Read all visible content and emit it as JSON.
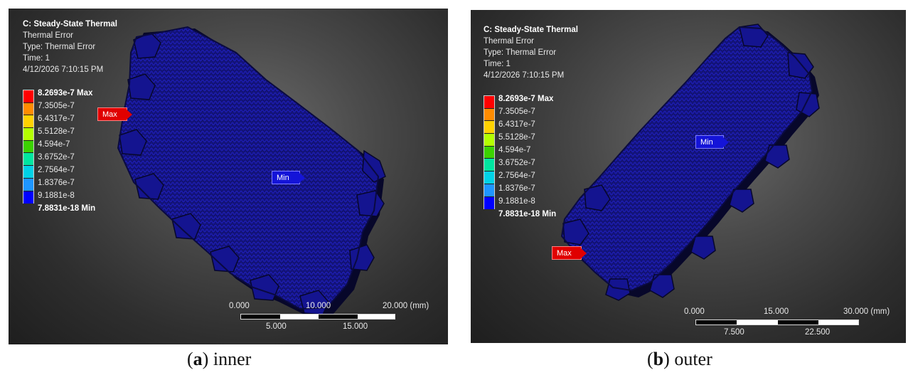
{
  "panels": [
    {
      "info": {
        "title": "C: Steady-State Thermal",
        "line2": "Thermal Error",
        "line3": "Type: Thermal Error",
        "line4": "Time: 1",
        "line5": "4/12/2026 7:10:15 PM"
      },
      "legend": {
        "colors": [
          "#ff0000",
          "#ff8c00",
          "#ffd200",
          "#b4ff00",
          "#3cd200",
          "#00e6a0",
          "#00d2e6",
          "#1e96ff",
          "#0000ff"
        ],
        "labels": [
          "8.2693e-7 Max",
          "7.3505e-7",
          "6.4317e-7",
          "5.5128e-7",
          "4.594e-7",
          "3.6752e-7",
          "2.7564e-7",
          "1.8376e-7",
          "9.1881e-8",
          "7.8831e-18 Min"
        ]
      },
      "probe": {
        "max": "Max",
        "min": "Min"
      },
      "scale": {
        "top": [
          "0.000",
          "10.000",
          "20.000 (mm)"
        ],
        "bottom": [
          "5.000",
          "15.000"
        ]
      },
      "caption": {
        "letter": "a",
        "text": "inner"
      }
    },
    {
      "info": {
        "title": "C: Steady-State Thermal",
        "line2": "Thermal Error",
        "line3": "Type: Thermal Error",
        "line4": "Time: 1",
        "line5": "4/12/2026 7:10:15 PM"
      },
      "legend": {
        "colors": [
          "#ff0000",
          "#ff8c00",
          "#ffd200",
          "#b4ff00",
          "#3cd200",
          "#00e6a0",
          "#00d2e6",
          "#1e96ff",
          "#0000ff"
        ],
        "labels": [
          "8.2693e-7 Max",
          "7.3505e-7",
          "6.4317e-7",
          "5.5128e-7",
          "4.594e-7",
          "3.6752e-7",
          "2.7564e-7",
          "1.8376e-7",
          "9.1881e-8",
          "7.8831e-18 Min"
        ]
      },
      "probe": {
        "max": "Max",
        "min": "Min"
      },
      "scale": {
        "top": [
          "0.000",
          "15.000",
          "30.000 (mm)"
        ],
        "bottom": [
          "7.500",
          "22.500"
        ]
      },
      "caption": {
        "letter": "b",
        "text": "outer"
      }
    }
  ],
  "colors": {
    "mesh_fill": "#1a1aa0",
    "mesh_dark": "#0a0a4a",
    "edge_shadow": "#050520"
  }
}
